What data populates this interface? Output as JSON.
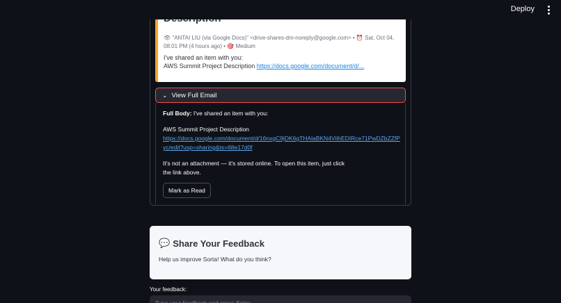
{
  "topbar": {
    "deploy_label": "Deploy",
    "menu_icon": "kebab-menu-icon"
  },
  "email": {
    "subject": "Description",
    "meta_sender": "👁 \"ANTAI LIU (via Google Docs)\" <drive-shares-dm-noreply@google.com> • ⏰ Sat, Oct 04, 08:01 PM (4 hours ago) • 🎯 Medium",
    "body_line1": "I've shared an item with you:",
    "body_line2_text": "AWS Summit Project Description ",
    "body_line2_link": "https://docs.google.com/document/d/..."
  },
  "expander": {
    "label": "View Full Email",
    "full_body_label": "Full Body:",
    "full_body_text": " I've shared an item with you:",
    "project_line": "AWS Summit Project Description",
    "full_link": "https://docs.google.com/document/d/16nxgC9jDK6gTHAlaBKN4ViihEDIRce71PwDZbZZfPyc/edit?usp=sharing&ts=68e17d0f",
    "note_line1": "It's not an attachment — it's stored online. To open this item, just click",
    "note_line2": "the link above.",
    "mark_read_label": "Mark as Read"
  },
  "feedback": {
    "icon": "💬",
    "title": "Share Your Feedback",
    "subtitle": "Help us improve Sorta! What do you think?",
    "input_label": "Your feedback:",
    "input_placeholder": "Type your feedback and press Enter"
  }
}
